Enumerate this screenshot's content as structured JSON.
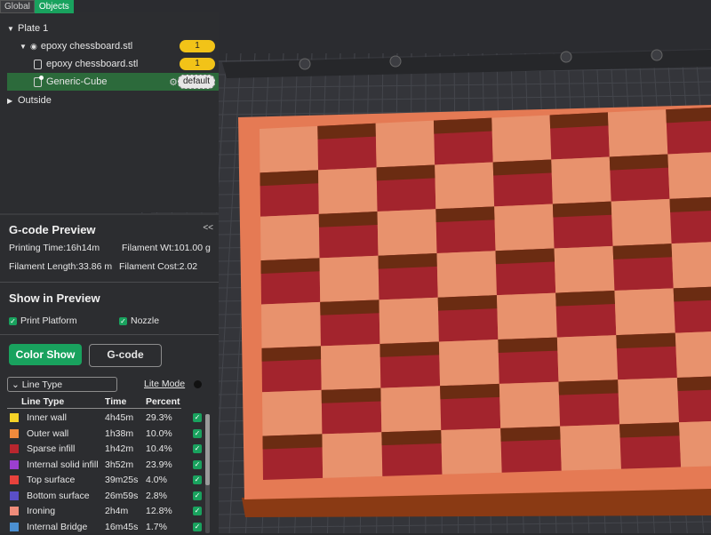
{
  "tabs": {
    "global": "Global",
    "objects": "Objects"
  },
  "objects": {
    "plate": "Plate 1",
    "model": {
      "name": "epoxy chessboard.stl",
      "count": "1"
    },
    "part": {
      "name": "epoxy chessboard.stl",
      "count": "1"
    },
    "modifier": {
      "name": "Generic-Cube",
      "badge": "default"
    },
    "outside": "Outside"
  },
  "gcode_preview": {
    "title": "G-code Preview",
    "collapse_icon": "<<",
    "printing_time": "Printing Time:16h14m",
    "filament_weight": "Filament Wt:101.00 g",
    "filament_length": "Filament Length:33.86 m",
    "filament_cost": "Filament Cost:2.02"
  },
  "show_in_preview": {
    "title": "Show in Preview",
    "print_platform": "Print Platform",
    "nozzle": "Nozzle"
  },
  "view_buttons": {
    "color_show": "Color Show",
    "gcode": "G-code"
  },
  "line_type_select": "Line Type",
  "lite_mode": "Lite Mode",
  "table": {
    "headers": {
      "line_type": "Line Type",
      "time": "Time",
      "percent": "Percent"
    },
    "rows": [
      {
        "name": "Inner wall",
        "time": "4h45m",
        "percent": "29.3%",
        "color": "#f5d327"
      },
      {
        "name": "Outer wall",
        "time": "1h38m",
        "percent": "10.0%",
        "color": "#f08a3c"
      },
      {
        "name": "Sparse infill",
        "time": "1h42m",
        "percent": "10.4%",
        "color": "#b8262e"
      },
      {
        "name": "Internal solid infill",
        "time": "3h52m",
        "percent": "23.9%",
        "color": "#9b3fcf"
      },
      {
        "name": "Top surface",
        "time": "39m25s",
        "percent": "4.0%",
        "color": "#e8423c"
      },
      {
        "name": "Bottom surface",
        "time": "26m59s",
        "percent": "2.8%",
        "color": "#5a4fc7"
      },
      {
        "name": "Ironing",
        "time": "2h4m",
        "percent": "12.8%",
        "color": "#ef8c7a"
      },
      {
        "name": "Internal Bridge",
        "time": "16m45s",
        "percent": "1.7%",
        "color": "#4b8fd1"
      }
    ]
  },
  "colors": {
    "accent": "#19a25e",
    "board_frame": "#e57a54",
    "square_light": "#e8926d",
    "square_dark": "#a3242d",
    "square_shadow": "#6b2c12"
  }
}
